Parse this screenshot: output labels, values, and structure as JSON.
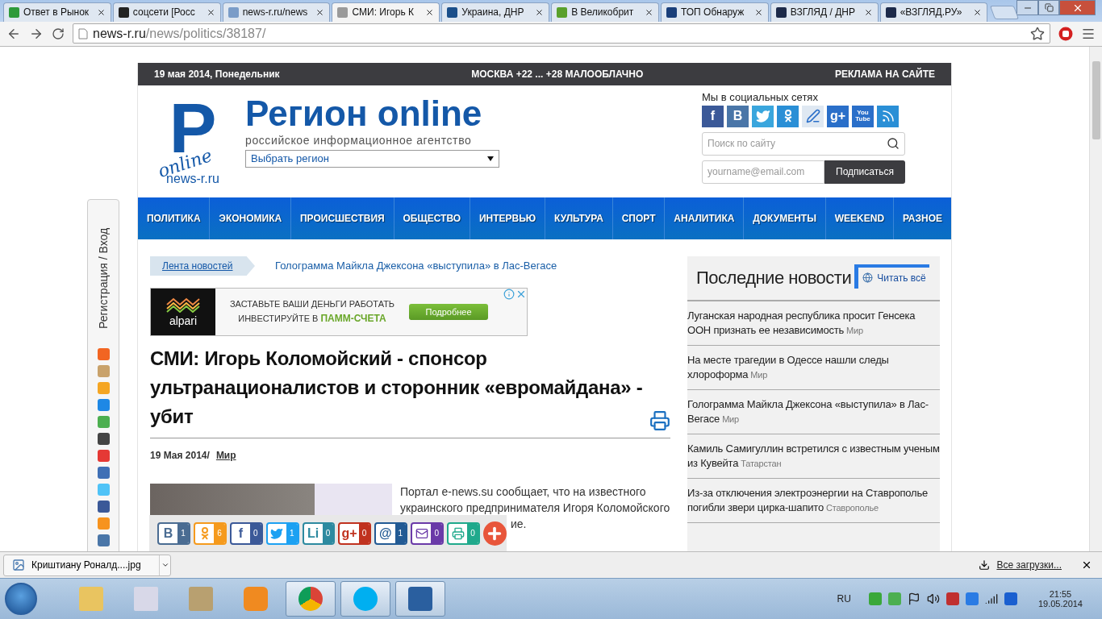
{
  "browser": {
    "tabs": [
      {
        "title": "Ответ в Рынок",
        "selected": false,
        "color": "#2e9a3a"
      },
      {
        "title": "соцсети [Росс",
        "selected": false,
        "color": "#222222"
      },
      {
        "title": "news-r.ru/news",
        "selected": false,
        "color": "#7a9cc8"
      },
      {
        "title": "СМИ: Игорь К",
        "selected": true,
        "color": "#9a9a9a"
      },
      {
        "title": "Украина, ДНР",
        "selected": false,
        "color": "#1b4f8a"
      },
      {
        "title": "В Великобрит",
        "selected": false,
        "color": "#5aa02c"
      },
      {
        "title": "ТОП Обнаруж",
        "selected": false,
        "color": "#1a3f7a"
      },
      {
        "title": "ВЗГЛЯД / ДНР",
        "selected": false,
        "color": "#1d2a4a"
      },
      {
        "title": "«ВЗГЛЯД.РУ»",
        "selected": false,
        "color": "#1d2a4a"
      }
    ],
    "url_host": "news-r.ru",
    "url_path": "/news/politics/38187/"
  },
  "page": {
    "topbar": {
      "date": "19 мая 2014, Понедельник",
      "weather": "МОСКВА +22 ... +28 МАЛООБЛАЧНО",
      "ads": "РЕКЛАМА НА САЙТЕ"
    },
    "header": {
      "logo_letter": "P",
      "logo_script": "online",
      "logo_domain": "news-r.ru",
      "site_title": "Регион online",
      "tagline": "российское информационное агентство",
      "region_select": "Выбрать регион",
      "social_label": "Мы в социальных сетях",
      "socials": [
        {
          "kind": "letter",
          "glyph": "f",
          "color": "#3b5998"
        },
        {
          "kind": "letter",
          "glyph": "B",
          "color": "#4a76a8"
        },
        {
          "kind": "twitter",
          "color": "#3aa6dd"
        },
        {
          "kind": "ok",
          "color": "#2a8fd6"
        },
        {
          "kind": "pen",
          "color": "#dfe8f2"
        },
        {
          "kind": "letter",
          "glyph": "g+",
          "color": "#2a6fc9"
        },
        {
          "kind": "letter",
          "glyph": "You Tube",
          "color": "#2a6fc9"
        },
        {
          "kind": "rss",
          "color": "#2a8fd6"
        }
      ],
      "search_placeholder": "Поиск по сайту",
      "email_placeholder": "yourname@email.com",
      "subscribe": "Подписаться"
    },
    "nav": [
      "ПОЛИТИКА",
      "ЭКОНОМИКА",
      "ПРОИСШЕСТВИЯ",
      "ОБЩЕСТВО",
      "ИНТЕРВЬЮ",
      "КУЛЬТУРА",
      "СПОРТ",
      "АНАЛИТИКА",
      "ДОКУМЕНТЫ",
      "WEEKEND",
      "РАЗНОЕ"
    ],
    "side_panel": {
      "login": "Регистрация / Вход",
      "icons": [
        {
          "color": "#f26522"
        },
        {
          "color": "#c9a26b"
        },
        {
          "color": "#f5a623"
        },
        {
          "color": "#1e88e5"
        },
        {
          "color": "#4caf50"
        },
        {
          "color": "#444444"
        },
        {
          "color": "#e53935"
        },
        {
          "color": "#3f6fb5"
        },
        {
          "color": "#4fc3f7"
        },
        {
          "color": "#3b5998"
        },
        {
          "color": "#f7931e"
        },
        {
          "color": "#4a76a8"
        }
      ]
    },
    "ticker": {
      "label": "Лента новостей",
      "headline": "Голограмма Майкла Джексона «выступила» в Лас-Вегасе"
    },
    "ad": {
      "brand": "alpari",
      "line1": "ЗАСТАВЬТЕ ВАШИ ДЕНЬГИ РАБОТАТЬ",
      "line2": "ИНВЕСТИРУЙТЕ В",
      "highlight": "ПАММ-СЧЕТА",
      "button": "Подробнее"
    },
    "article": {
      "title": "СМИ: Игорь Коломойский - спонсор ультранационалистов и сторонник «евромайдана» - убит",
      "date": "19 Мая 2014/",
      "category": "Мир",
      "lead": "Портал e-news.su сообщает, что на известного украинского предпринимателя Игоря Коломойского",
      "lead_tail": "ие."
    },
    "share": [
      {
        "kind": "letter",
        "glyph": "В",
        "count": "1",
        "color": "#4a6c92"
      },
      {
        "kind": "ok",
        "count": "6",
        "color": "#f59a1d"
      },
      {
        "kind": "letter",
        "glyph": "f",
        "count": "0",
        "color": "#3b5998"
      },
      {
        "kind": "twitter",
        "count": "1",
        "color": "#1da1f2"
      },
      {
        "kind": "letter",
        "glyph": "Li",
        "count": "0",
        "color": "#2d8aa0"
      },
      {
        "kind": "letter",
        "glyph": "g+",
        "count": "0",
        "color": "#c0321f"
      },
      {
        "kind": "letter",
        "glyph": "@",
        "count": "1",
        "color": "#225a94"
      },
      {
        "kind": "mail",
        "count": "0",
        "color": "#6a3aa8"
      },
      {
        "kind": "print",
        "count": "0",
        "color": "#20a98c"
      }
    ],
    "sidebar": {
      "title": "Последние новости",
      "read_all": "Читать всё",
      "items": [
        {
          "headline": "Луганская народная республика просит Генсека ООН признать ее независимость",
          "region": "Мир"
        },
        {
          "headline": "На месте трагедии в Одессе нашли следы хлороформа",
          "region": "Мир"
        },
        {
          "headline": "Голограмма Майкла Джексона «выступила» в Лас-Вегасе",
          "region": "Мир"
        },
        {
          "headline": "Камиль Самигуллин встретился с известным ученым из Кувейта",
          "region": "Татарстан"
        },
        {
          "headline": "Из-за отключения электроэнергии на Ставрополье погибли звери цирка-шапито",
          "region": "Ставрополье"
        }
      ]
    }
  },
  "downloads": {
    "file": "Криштиану Роналд....jpg",
    "all": "Все загрузки..."
  },
  "taskbar": {
    "apps": [
      {
        "kind": "folder",
        "selected": false
      },
      {
        "kind": "chart",
        "selected": false
      },
      {
        "kind": "drive",
        "selected": false
      },
      {
        "kind": "player",
        "selected": false
      },
      {
        "kind": "chrome",
        "selected": true
      },
      {
        "kind": "skype",
        "selected": true
      },
      {
        "kind": "house",
        "selected": true
      }
    ],
    "lang": "RU",
    "time": "21:55",
    "date": "19.05.2014"
  }
}
